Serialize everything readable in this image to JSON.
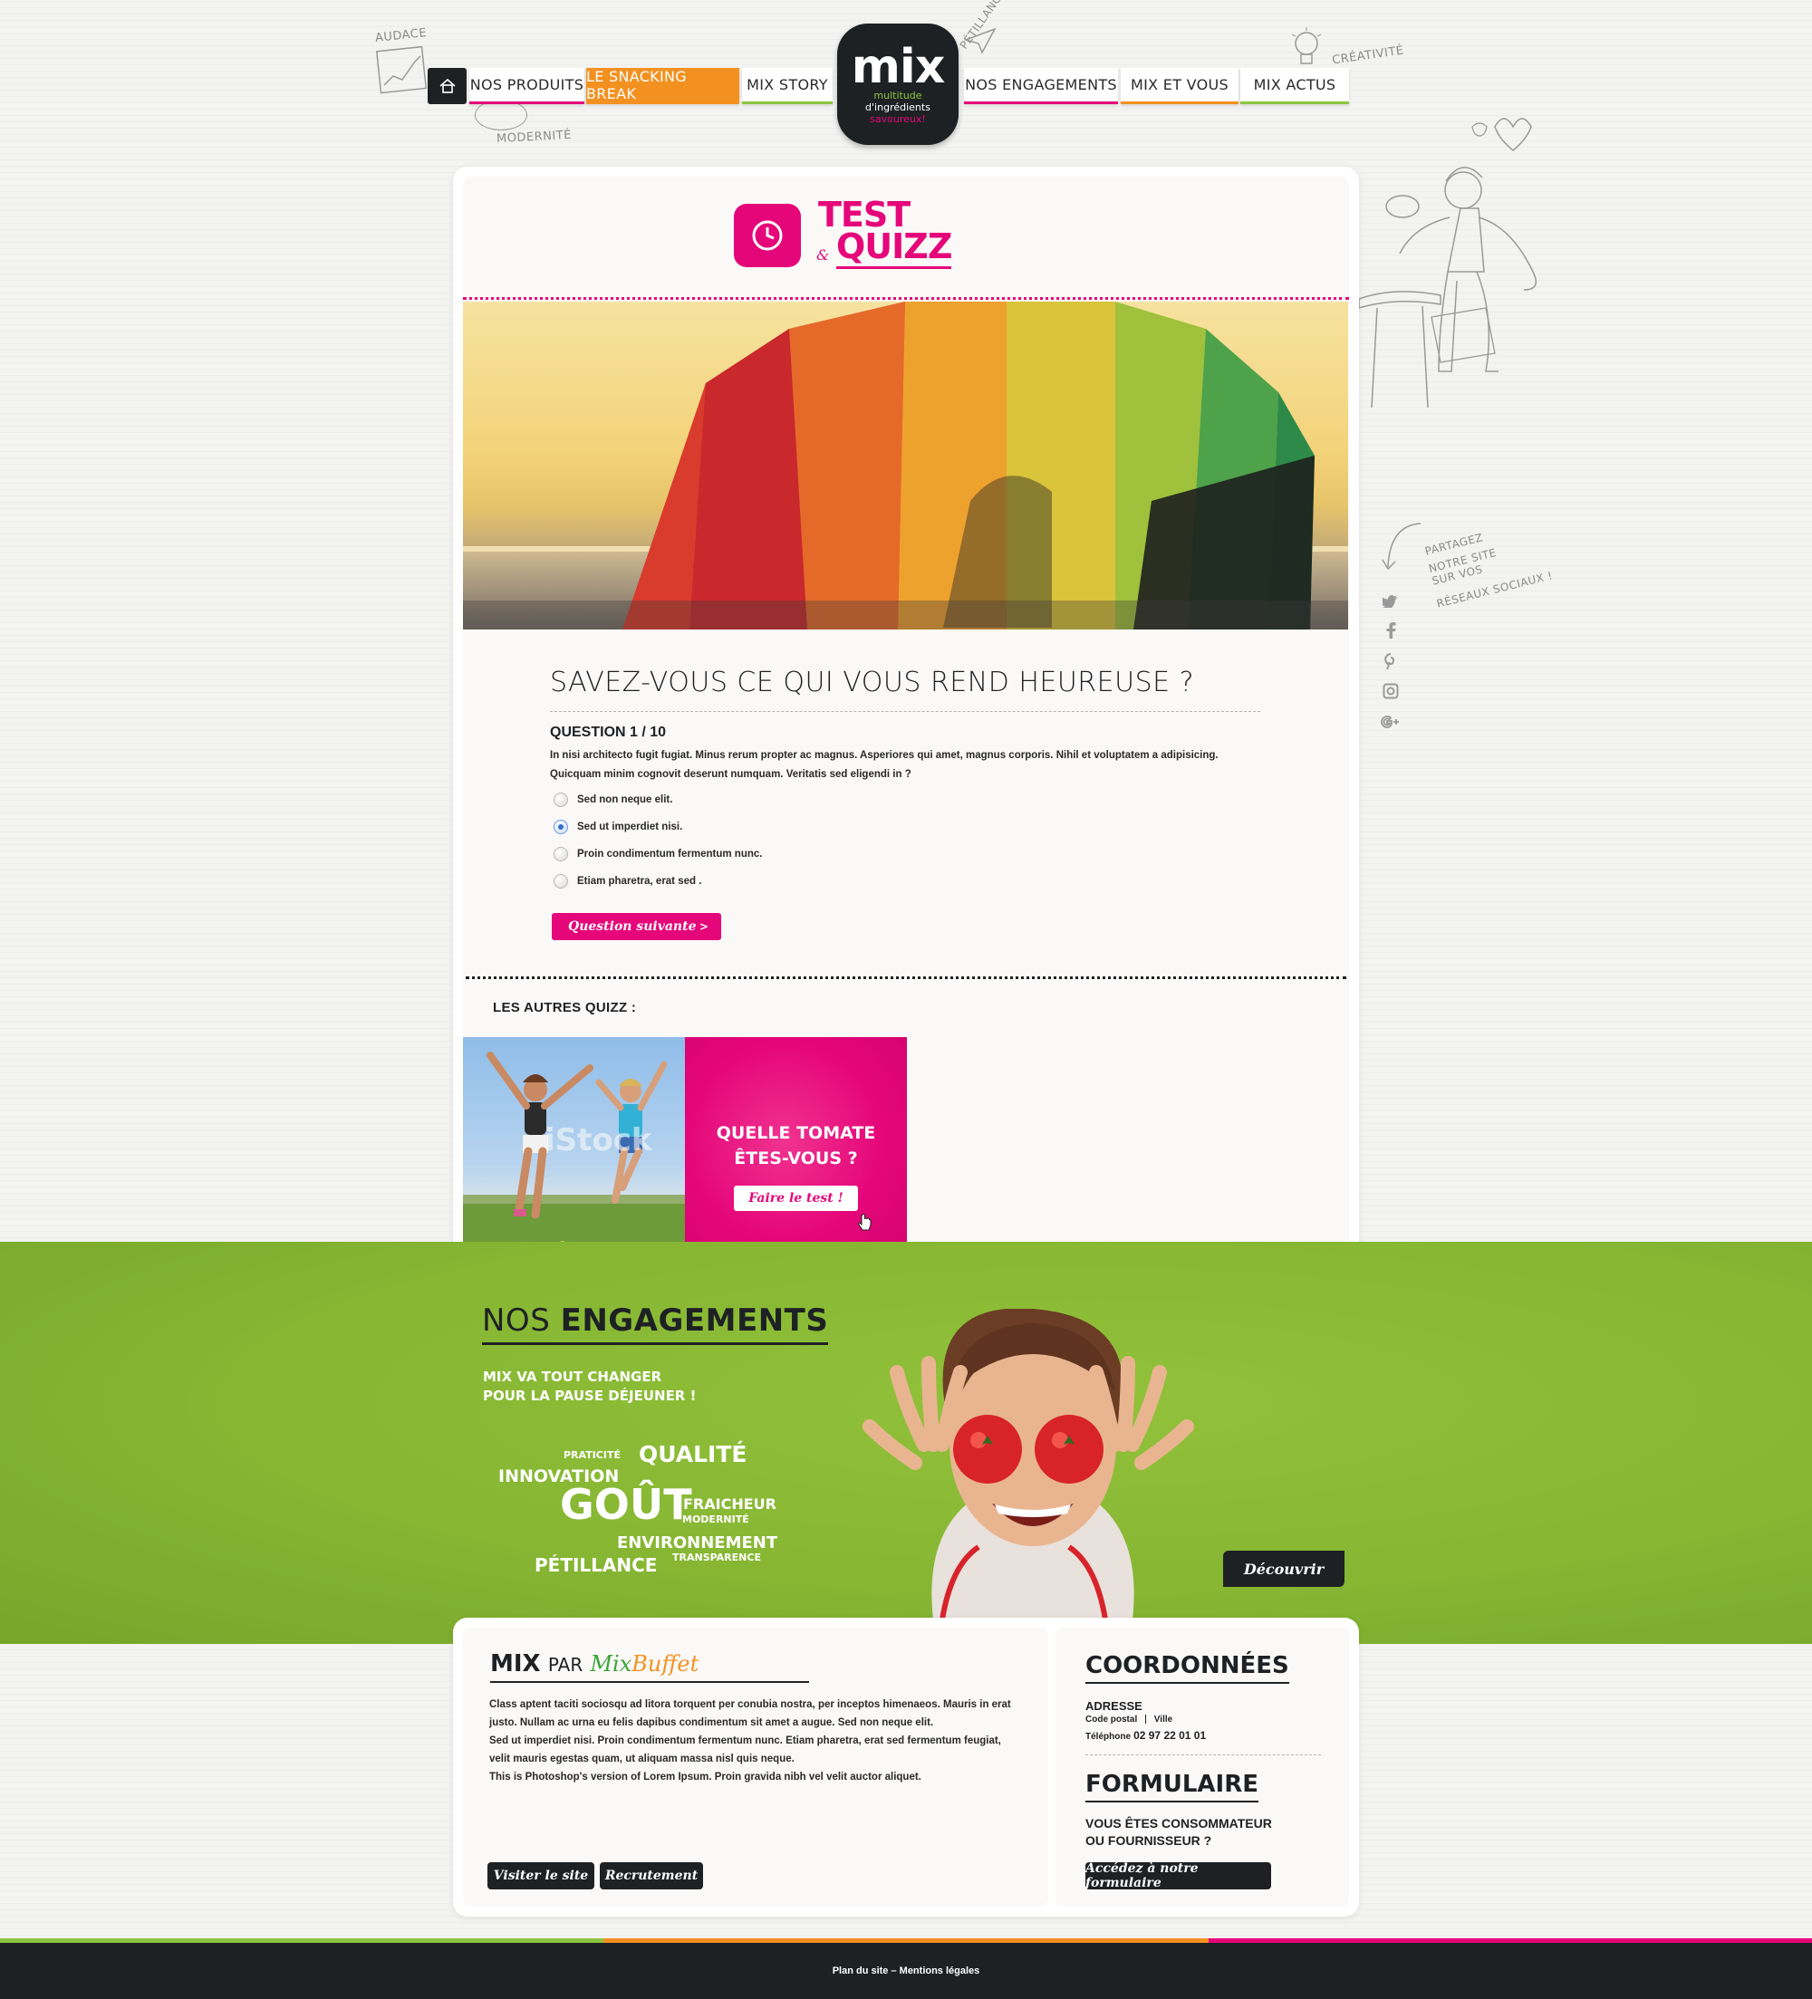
{
  "nav": {
    "left_items": [
      "NOS PRODUITS",
      "LE SNACKING BREAK",
      "MIX STORY"
    ],
    "right_items": [
      "NOS ENGAGEMENTS",
      "MIX ET VOUS",
      "MIX ACTUS"
    ],
    "active": "LE SNACKING BREAK"
  },
  "logo": {
    "main": "mix",
    "sub1": "multitude",
    "sub2": "d'ingrédients",
    "sub3": "savoureux!"
  },
  "doodles": {
    "audace": "AUDACE",
    "modernite": "MODERNITÉ",
    "petillance": "PÉTILLANCE",
    "creativite": "CRÉATIVITÉ",
    "share_1": "PARTAGEZ",
    "share_2": "NOTRE SITE",
    "share_3": "SUR VOS",
    "share_4": "RÉSEAUX SOCIAUX !"
  },
  "social": [
    "twitter-icon",
    "facebook-icon",
    "pinterest-icon",
    "instagram-icon",
    "google-plus-icon"
  ],
  "quiz": {
    "title_1": "TEST",
    "title_amp": "&",
    "title_2": "QUIZZ",
    "question_title": "SAVEZ-VOUS CE QUI VOUS REND HEUREUSE ?",
    "question_num": "QUESTION 1 / 10",
    "question_text_1": "In nisi architecto fugit fugiat. Minus rerum propter ac magnus. Asperiores qui amet, magnus corporis. Nihil et voluptatem a adipisicing.",
    "question_text_2": "Quicquam minim cognovit deserunt numquam. Veritatis sed eligendi in ?",
    "options": [
      {
        "label": "Sed non neque elit.",
        "checked": false
      },
      {
        "label": "Sed ut imperdiet nisi.",
        "checked": true
      },
      {
        "label": "Proin condimentum fermentum nunc.",
        "checked": false
      },
      {
        "label": "Etiam pharetra, erat sed .",
        "checked": false
      }
    ],
    "next_label": "Question suivante",
    "next_arrow": ">",
    "autres": "LES AUTRES QUIZZ :",
    "watermark": "iStock",
    "promo_title_1": "QUELLE TOMATE",
    "promo_title_2": "ÊTES-VOUS ?",
    "promo_btn": "Faire le test !"
  },
  "engagements": {
    "title_light": "NOS",
    "title_bold": "ENGAGEMENTS",
    "sub_1": "MIX VA TOUT CHANGER",
    "sub_2": "POUR LA PAUSE DÉJEUNER !",
    "words": {
      "praticite": "PRATICITÉ",
      "qualite": "QUALITÉ",
      "innovation": "INNOVATION",
      "gout": "GOÛT",
      "fraicheur": "FRAICHEUR",
      "modernite": "MODERNITÉ",
      "environnement": "ENVIRONNEMENT",
      "transparence": "TRANSPARENCE",
      "petillance": "PÉTILLANCE"
    },
    "cta": "Découvrir"
  },
  "footer": {
    "mix": "MIX",
    "par": "PAR",
    "mixbuffet_1": "Mix",
    "mixbuffet_2": "Buffet",
    "text_1": "Class aptent taciti sociosqu ad litora torquent per conubia nostra, per inceptos himenaeos. Mauris in erat",
    "text_2": "justo. Nullam ac urna eu felis dapibus condimentum sit amet a augue. Sed non neque elit.",
    "text_3": "Sed ut imperdiet nisi. Proin condimentum fermentum nunc. Etiam pharetra, erat sed fermentum feugiat,",
    "text_4": "velit mauris egestas quam, ut aliquam massa nisl quis neque.",
    "text_5": "This is Photoshop's version  of Lorem Ipsum. Proin gravida nibh vel velit auctor aliquet.",
    "btn_site": "Visiter le site",
    "btn_recrutement": "Recrutement",
    "coord_title": "COORDONNÉES",
    "adresse": "ADRESSE",
    "cp": "Code postal",
    "ville": "Ville",
    "tel_label": "Téléphone",
    "tel": "02 97 22 01 01",
    "form_title": "FORMULAIRE",
    "form_q1": "VOUS ÊTES CONSOMMATEUR",
    "form_q2": "OU FOURNISSEUR ?",
    "form_btn": "Accédez à notre formulaire",
    "bottom": "Plan du site – Mentions légales"
  },
  "colors": {
    "pink": "#e5067a",
    "orange": "#f39120",
    "green": "#8bc53f",
    "dark": "#1e2124"
  }
}
